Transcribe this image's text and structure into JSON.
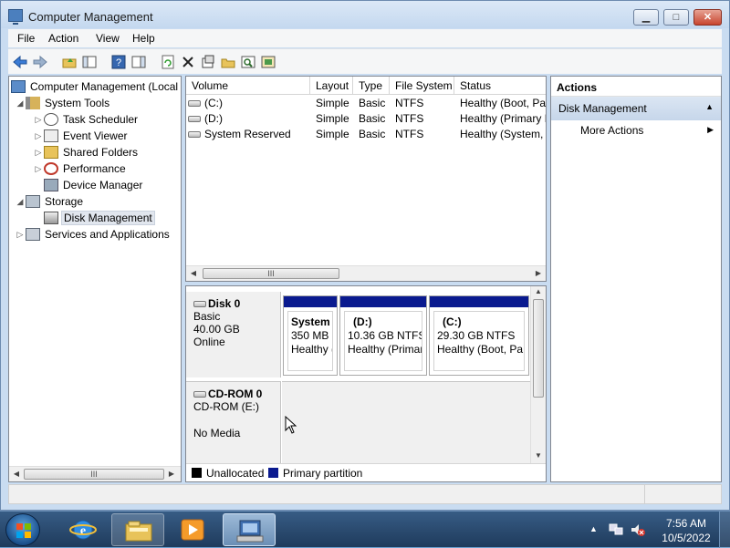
{
  "window": {
    "title": "Computer Management"
  },
  "menu": [
    "File",
    "Action",
    "View",
    "Help"
  ],
  "toolbar": {
    "icons": [
      "back-arrow-icon",
      "forward-arrow-icon",
      "up-folder-icon",
      "show-hide-tree-icon",
      "help-icon",
      "show-hide-action-pane-icon",
      "refresh-icon",
      "delete-icon",
      "properties-icon",
      "open-icon",
      "search-icon",
      "help-topics-icon"
    ]
  },
  "tree": {
    "items": [
      {
        "label": "Computer Management (Local",
        "level": 0,
        "expander": ""
      },
      {
        "label": "System Tools",
        "level": 1,
        "expander": "open"
      },
      {
        "label": "Task Scheduler",
        "level": 2,
        "expander": "closed"
      },
      {
        "label": "Event Viewer",
        "level": 2,
        "expander": "closed"
      },
      {
        "label": "Shared Folders",
        "level": 2,
        "expander": "closed"
      },
      {
        "label": "Performance",
        "level": 2,
        "expander": "closed"
      },
      {
        "label": "Device Manager",
        "level": 2,
        "expander": ""
      },
      {
        "label": "Storage",
        "level": 1,
        "expander": "open"
      },
      {
        "label": "Disk Management",
        "level": 2,
        "expander": "",
        "selected": true
      },
      {
        "label": "Services and Applications",
        "level": 1,
        "expander": "closed"
      }
    ]
  },
  "volumes": {
    "columns": [
      "Volume",
      "Layout",
      "Type",
      "File System",
      "Status"
    ],
    "rows": [
      [
        "(C:)",
        "Simple",
        "Basic",
        "NTFS",
        "Healthy (Boot, Pa"
      ],
      [
        "(D:)",
        "Simple",
        "Basic",
        "NTFS",
        "Healthy (Primary I"
      ],
      [
        "System Reserved",
        "Simple",
        "Basic",
        "NTFS",
        "Healthy (System, /"
      ]
    ],
    "scroll_label": "III"
  },
  "disks": [
    {
      "name": "Disk 0",
      "lines": [
        "Basic",
        "40.00 GB",
        "Online"
      ],
      "partitions": [
        {
          "title": "System I",
          "line1": "350 MB N",
          "line2": "Healthy ("
        },
        {
          "title": "(D:)",
          "line1": "10.36 GB NTFS",
          "line2": "Healthy (Primar"
        },
        {
          "title": "(C:)",
          "line1": "29.30 GB NTFS",
          "line2": "Healthy (Boot, Pa"
        }
      ]
    },
    {
      "name": "CD-ROM 0",
      "lines": [
        "CD-ROM (E:)",
        "",
        "No Media"
      ]
    }
  ],
  "legend": [
    {
      "label": "Unallocated",
      "color": "#000000"
    },
    {
      "label": "Primary partition",
      "color": "#0a1a8f"
    }
  ],
  "actions": {
    "title": "Actions",
    "section": "Disk Management",
    "item": "More Actions"
  },
  "tree_scroll_label": "III",
  "taskbar": {
    "time": "7:56 AM",
    "date": "10/5/2022",
    "buttons": [
      "internet-explorer-icon",
      "windows-explorer-icon",
      "media-player-icon",
      "computer-management-icon"
    ]
  }
}
